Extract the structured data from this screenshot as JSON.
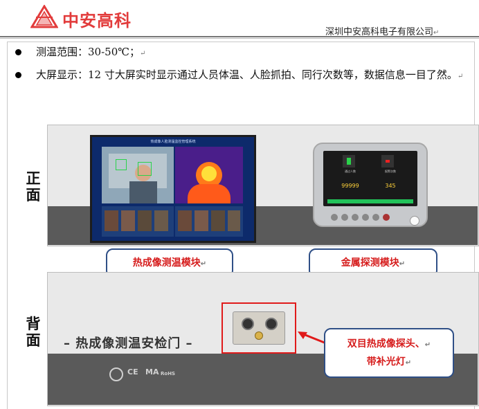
{
  "header": {
    "logo_text": "中安高科",
    "company_name": "深圳中安高科电子有限公司",
    "return_mark": "↵"
  },
  "bullets": [
    {
      "text": "测温范围：30-50℃；",
      "mark": "↵"
    },
    {
      "text": "大屏显示：12 寸大屏实时显示通过人员体温、人脸抓拍、同行次数等，数据信息一目了然。",
      "mark": "↵"
    }
  ],
  "front": {
    "label_1": "正",
    "label_2": "面",
    "screen_title": "热成像人脸测温监控管理系统",
    "metal_screen": {
      "left_caption": "通过人数",
      "right_caption": "报警次数",
      "left_value": "99999",
      "right_value": "345"
    }
  },
  "callouts": {
    "thermal_module": "热成像测温模块",
    "metal_module": "金属探测模块",
    "probe_line1": "双目热成像探头、",
    "probe_line2": "带补光灯",
    "mark": "↵"
  },
  "back": {
    "label_1": "背",
    "label_2": "面",
    "gate_title": "– 热成像测温安检门 –",
    "certs": [
      "CE",
      "MA",
      "RoHS"
    ]
  },
  "colors": {
    "logo_red": "#e23b3b",
    "callout_border": "#2f4f86",
    "callout_text": "#d61c1c",
    "highlight_red": "#e01a1a",
    "screen_blue": "#0d2a6b",
    "indicator_green": "#22c25a"
  }
}
